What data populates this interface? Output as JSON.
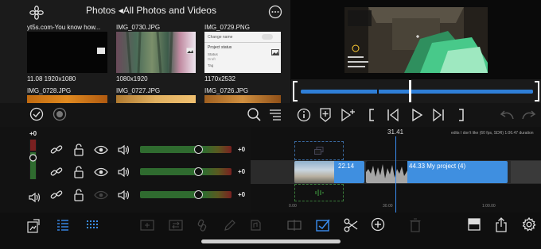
{
  "browser": {
    "title": "Photos ◂All Photos and Videos",
    "thumbs": [
      {
        "name": "yt5s.com-You know how...",
        "meta": "11.08  1920x1080"
      },
      {
        "name": "IMG_0730.JPG",
        "meta": "1080x1920"
      },
      {
        "name": "IMG_0729.PNG",
        "meta": "1170x2532"
      },
      {
        "name": "IMG_0728.JPG"
      },
      {
        "name": "IMG_0727.JPG"
      },
      {
        "name": "IMG_0726.JPG"
      }
    ],
    "mini_screenshot": {
      "title": "Change name",
      "section": "Project status",
      "row1": "Status",
      "row1_value": "Draft",
      "row2": "Tag"
    }
  },
  "tracks": [
    {
      "level": "+0",
      "value": "+0"
    },
    {
      "value": "+0"
    },
    {
      "value": "+0"
    }
  ],
  "timeline": {
    "playhead_time": "31.41",
    "project_info": "edits I don't like  (60 fps, SDR)  1:06.47 duration",
    "clip1_label": "22.14",
    "clip2_label": "44.33   My project (4)",
    "tick0": "0.00",
    "tick1": "30.00",
    "tick2": "1:00.00"
  },
  "colors": {
    "accent": "#3a8df0",
    "clip_blue": "#3f8fe0",
    "fader_green": "#2f6b2f",
    "fader_red": "#7a2020"
  }
}
